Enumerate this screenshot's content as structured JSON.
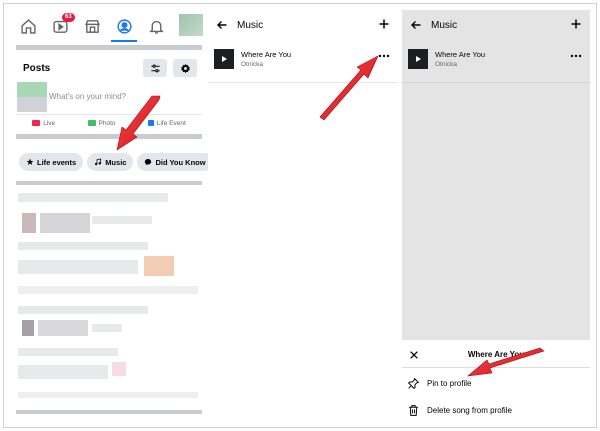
{
  "panel1": {
    "nav": {
      "notification_badge": "63"
    },
    "posts": {
      "title": "Posts",
      "composer_placeholder": "What's on your mind?"
    },
    "actions": [
      {
        "label": "Live",
        "color": "#f02849"
      },
      {
        "label": "Photo",
        "color": "#45bd62"
      },
      {
        "label": "Life Event",
        "color": "#1877f2"
      }
    ],
    "chips": [
      {
        "label": "Life events",
        "icon": "star-icon"
      },
      {
        "label": "Music",
        "icon": "music-note-icon"
      },
      {
        "label": "Did You Know",
        "icon": "chat-bubble-icon"
      }
    ]
  },
  "panel2": {
    "header_title": "Music",
    "song": {
      "title": "Where Are You",
      "artist": "Otnicka"
    }
  },
  "panel3": {
    "header_title": "Music",
    "song": {
      "title": "Where Are You",
      "artist": "Otnicka"
    },
    "sheet": {
      "title": "Where Are You",
      "items": [
        {
          "label": "Pin to profile",
          "icon": "pin-icon"
        },
        {
          "label": "Delete song from profile",
          "icon": "trash-icon"
        }
      ]
    }
  },
  "colors": {
    "accent": "#1877f2",
    "annotation_arrow": "#e8232a",
    "overlay": "#e4e4e4"
  }
}
